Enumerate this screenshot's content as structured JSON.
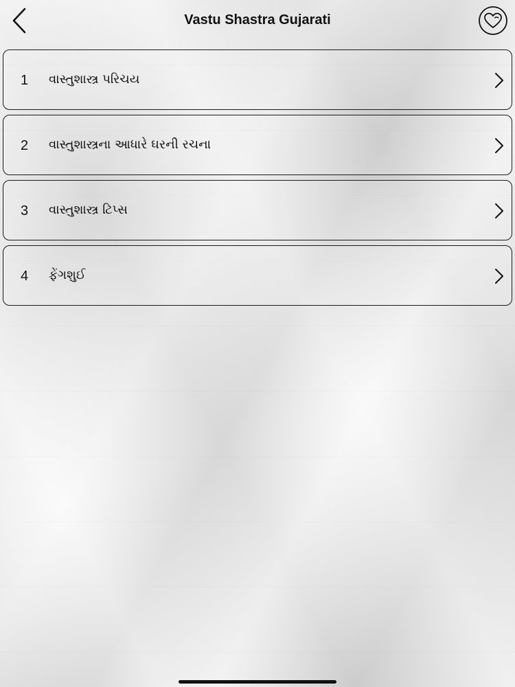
{
  "header": {
    "title": "Vastu Shastra Gujarati",
    "back_icon": "chevron-left-icon",
    "favorite_icon": "heart-circle-icon"
  },
  "menu": {
    "items": [
      {
        "number": "1",
        "label": "વાસ્તુશાસ્ત્ર પરિચય"
      },
      {
        "number": "2",
        "label": "વાસ્તુશાસ્ત્રના આધારે ઘરની રચના"
      },
      {
        "number": "3",
        "label": "વાસ્તુશાસ્ત્ર ટિપ્સ"
      },
      {
        "number": "4",
        "label": "ફેંગશુઈ"
      }
    ]
  },
  "colors": {
    "text": "#111111",
    "border": "#1a1a1a",
    "background": "#e7e7e7"
  }
}
